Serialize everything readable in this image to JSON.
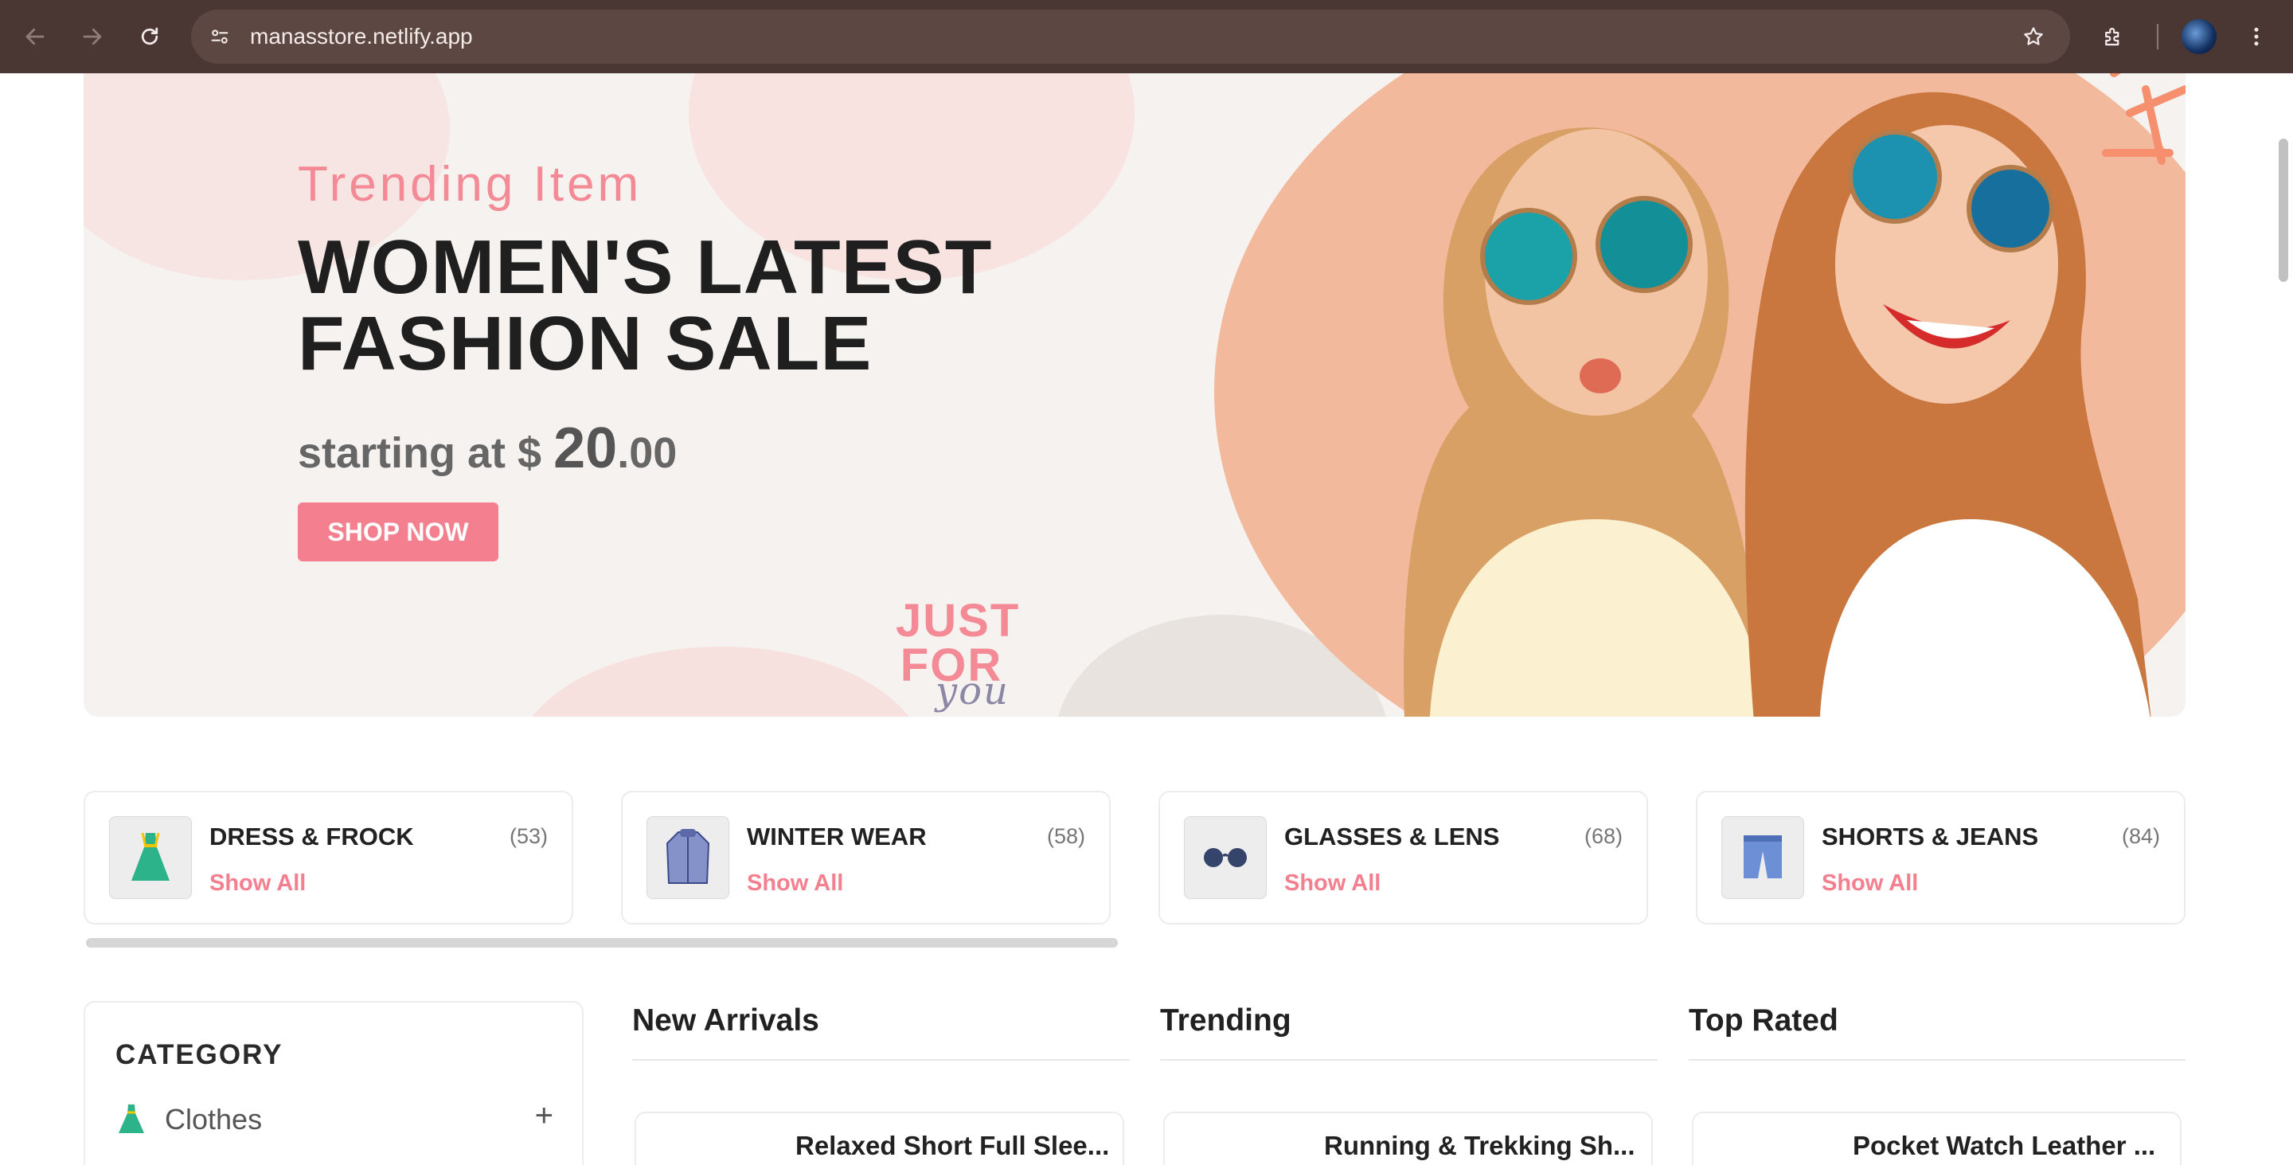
{
  "browser": {
    "url": "manasstore.netlify.app"
  },
  "hero": {
    "subtitle": "Trending Item",
    "title_line1": "WOMEN'S LATEST",
    "title_line2": "FASHION SALE",
    "price_prefix": "starting at $",
    "price_main": "20",
    "price_cents": ".00",
    "button_label": "SHOP NOW",
    "badge_line1": "JUST",
    "badge_line2": "FOR",
    "badge_line3": "you"
  },
  "categories": [
    {
      "name": "DRESS & FROCK",
      "count": "(53)",
      "link": "Show All",
      "icon": "dress-icon"
    },
    {
      "name": "WINTER WEAR",
      "count": "(58)",
      "link": "Show All",
      "icon": "coat-icon"
    },
    {
      "name": "GLASSES & LENS",
      "count": "(68)",
      "link": "Show All",
      "icon": "glasses-icon"
    },
    {
      "name": "SHORTS & JEANS",
      "count": "(84)",
      "link": "Show All",
      "icon": "shorts-icon"
    }
  ],
  "sidebar": {
    "title": "CATEGORY",
    "items": [
      {
        "label": "Clothes",
        "icon": "dress-icon",
        "toggle": "+"
      }
    ]
  },
  "columns": [
    {
      "title": "New Arrivals",
      "first_product": "Relaxed Short Full Slee..."
    },
    {
      "title": "Trending",
      "first_product": "Running & Trekking Sh..."
    },
    {
      "title": "Top Rated",
      "first_product": "Pocket Watch Leather ..."
    }
  ],
  "colors": {
    "accent": "#f37f8f",
    "chrome": "#4a3734",
    "omnibox": "#5d4743",
    "hero_bg": "#f5f2ef"
  }
}
